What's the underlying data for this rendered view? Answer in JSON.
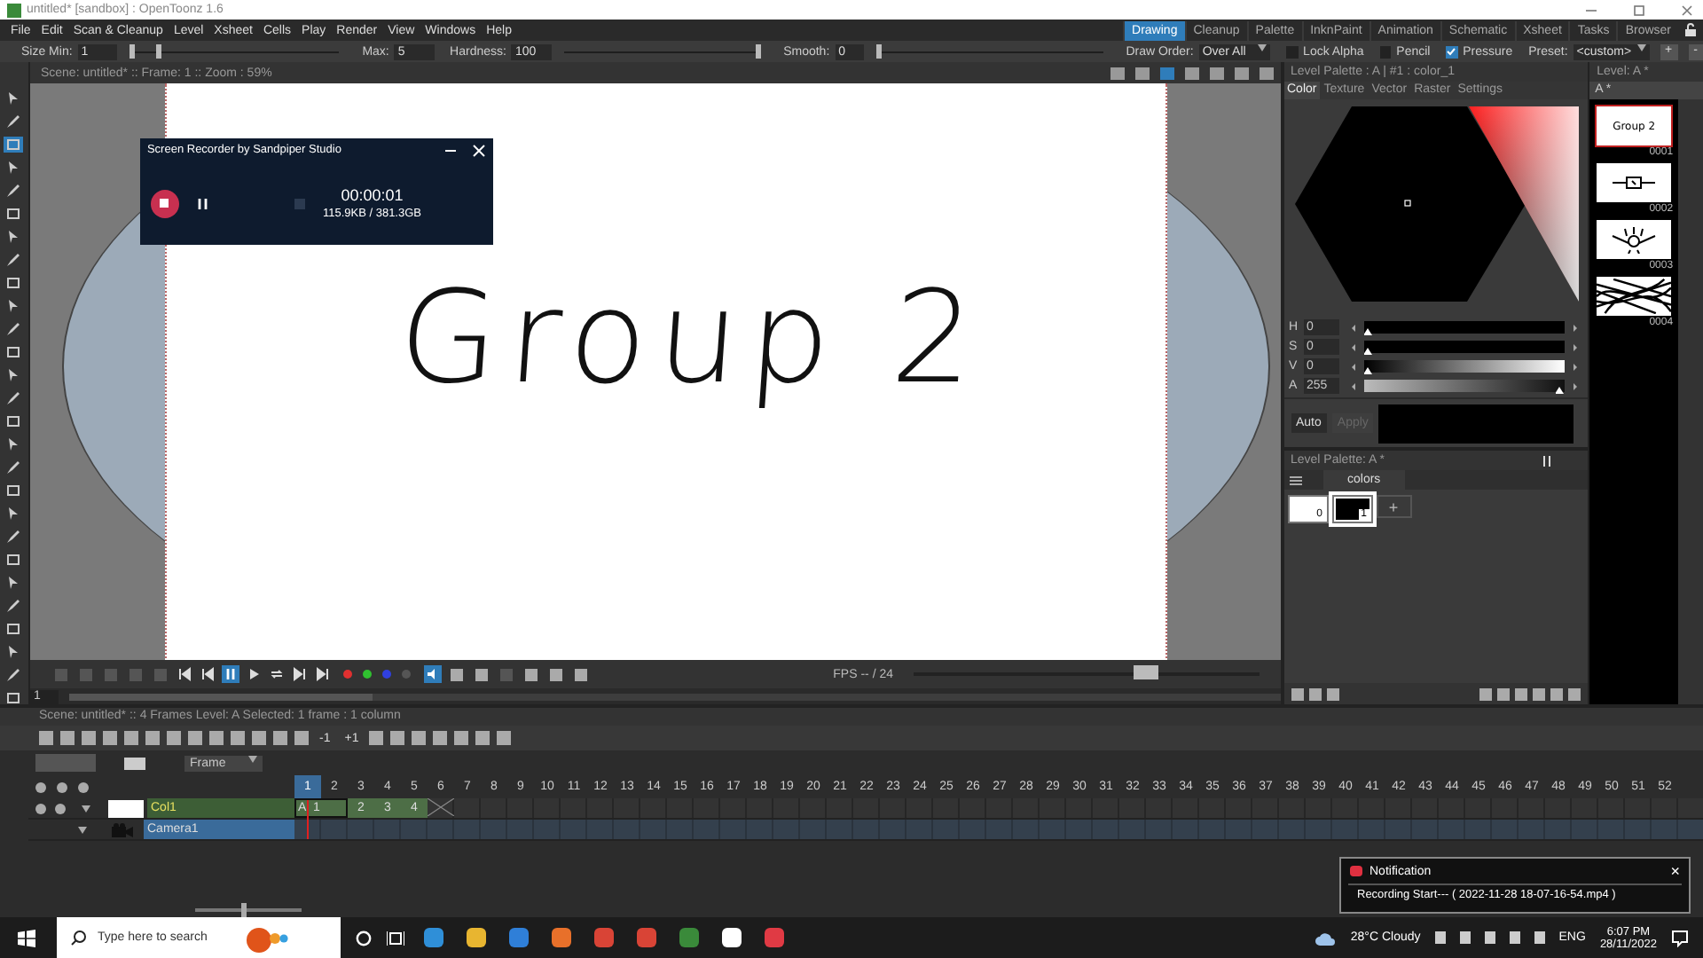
{
  "window": {
    "title": "untitled* [sandbox] : OpenToonz 1.6"
  },
  "menu": [
    "File",
    "Edit",
    "Scan & Cleanup",
    "Level",
    "Xsheet",
    "Cells",
    "Play",
    "Render",
    "View",
    "Windows",
    "Help"
  ],
  "rooms": [
    {
      "label": "Drawing",
      "selected": true
    },
    {
      "label": "Cleanup",
      "selected": false
    },
    {
      "label": "Palette",
      "selected": false
    },
    {
      "label": "InknPaint",
      "selected": false
    },
    {
      "label": "Animation",
      "selected": false
    },
    {
      "label": "Schematic",
      "selected": false
    },
    {
      "label": "Xsheet",
      "selected": false
    },
    {
      "label": "Tasks",
      "selected": false
    },
    {
      "label": "Browser",
      "selected": false
    }
  ],
  "tool_options": {
    "size_min_label": "Size Min:",
    "size_min": "1",
    "size_slider": [
      {
        "level": 0.0
      },
      {
        "level": 0.13
      }
    ],
    "max_label": "Max:",
    "max": "5",
    "hardness_label": "Hardness:",
    "hardness": "100",
    "hardness_slider": {
      "level": 1.0
    },
    "smooth_label": "Smooth:",
    "smooth": "0",
    "smooth_slider": {
      "level": 0.0
    },
    "draw_order_label": "Draw Order:",
    "draw_order": "Over All",
    "toggles": [
      {
        "label": "Lock Alpha",
        "checked": false
      },
      {
        "label": "Pencil",
        "checked": false
      },
      {
        "label": "Pressure",
        "checked": true
      }
    ],
    "preset_label": "Preset:",
    "preset": "<custom>",
    "buttons": [
      "+",
      "-"
    ]
  },
  "tools": [
    {
      "selected": false
    },
    {
      "selected": false
    },
    {
      "selected": true
    },
    {
      "selected": false
    },
    {
      "selected": false
    },
    {
      "selected": false
    },
    {
      "selected": false
    },
    {
      "selected": false
    },
    {
      "selected": false
    },
    {
      "selected": false
    },
    {
      "selected": false
    },
    {
      "selected": false
    },
    {
      "selected": false
    },
    {
      "selected": false
    },
    {
      "selected": false
    },
    {
      "selected": false
    },
    {
      "selected": false
    },
    {
      "selected": false
    },
    {
      "selected": false
    },
    {
      "selected": false
    },
    {
      "selected": false
    },
    {
      "selected": false
    },
    {
      "selected": false
    },
    {
      "selected": false
    },
    {
      "selected": false
    },
    {
      "selected": false
    },
    {
      "selected": false
    }
  ],
  "viewer": {
    "title": "Scene: untitled*  ::  Frame: 1  ::  Zoom : 59%",
    "drawing_text": "Group 2"
  },
  "recorder": {
    "title": "Screen Recorder by Sandpiper Studio",
    "time": "00:00:01",
    "size": "115.9KB / 381.3GB"
  },
  "playback": {
    "fps": "FPS -- / 24",
    "fps_slider": {
      "level": 0.69
    },
    "frame": "1",
    "frame_slider": {
      "level": 0.25
    }
  },
  "palette": {
    "title": "Level Palette : A | #1 : color_1",
    "tabs": [
      {
        "label": "Color",
        "selected": true
      },
      {
        "label": "Texture",
        "selected": false
      },
      {
        "label": "Vector",
        "selected": false
      },
      {
        "label": "Raster",
        "selected": false
      },
      {
        "label": "Settings",
        "selected": false
      }
    ],
    "channels": [
      {
        "name": "H",
        "value": "0",
        "level": 0.0
      },
      {
        "name": "S",
        "value": "0",
        "level": 0.0
      },
      {
        "name": "V",
        "value": "0",
        "level": 0.0
      },
      {
        "name": "A",
        "value": "255",
        "level": 1.0
      }
    ],
    "auto": "Auto",
    "apply": {
      "label": "Apply",
      "disabled": true
    }
  },
  "level_palette": {
    "title": "Level Palette: A *",
    "page": "colors",
    "styles": [
      {
        "index": "0",
        "selected": false
      },
      {
        "index": "1",
        "selected": true
      }
    ],
    "add": "+"
  },
  "level_strip": {
    "title": "Level: A *",
    "level": "A *",
    "frames": [
      {
        "number": "0001",
        "selected": true,
        "text": "Group 2"
      },
      {
        "number": "0002",
        "selected": false
      },
      {
        "number": "0003",
        "selected": false
      },
      {
        "number": "0004",
        "selected": false
      }
    ]
  },
  "xsheet": {
    "title": "Scene: untitled*  ::  4 Frames  Level: A   Selected: 1 frame : 1 column",
    "step_buttons": [
      "-1",
      "+1"
    ],
    "frame_mode": "Frame",
    "zoom_slider": {
      "level": 0.45
    },
    "frames": [
      {
        "label": "1",
        "selected": true
      },
      {
        "label": "2",
        "selected": false
      },
      {
        "label": "3",
        "selected": false
      },
      {
        "label": "4",
        "selected": false
      },
      {
        "label": "5",
        "selected": false
      },
      {
        "label": "6",
        "selected": false
      },
      {
        "label": "7",
        "selected": false
      },
      {
        "label": "8",
        "selected": false
      },
      {
        "label": "9",
        "selected": false
      },
      {
        "label": "10",
        "selected": false
      },
      {
        "label": "11",
        "selected": false
      },
      {
        "label": "12",
        "selected": false
      },
      {
        "label": "13",
        "selected": false
      },
      {
        "label": "14",
        "selected": false
      },
      {
        "label": "15",
        "selected": false
      },
      {
        "label": "16",
        "selected": false
      },
      {
        "label": "17",
        "selected": false
      },
      {
        "label": "18",
        "selected": false
      },
      {
        "label": "19",
        "selected": false
      },
      {
        "label": "20",
        "selected": false
      },
      {
        "label": "21",
        "selected": false
      },
      {
        "label": "22",
        "selected": false
      },
      {
        "label": "23",
        "selected": false
      },
      {
        "label": "24",
        "selected": false
      },
      {
        "label": "25",
        "selected": false
      },
      {
        "label": "26",
        "selected": false
      },
      {
        "label": "27",
        "selected": false
      },
      {
        "label": "28",
        "selected": false
      },
      {
        "label": "29",
        "selected": false
      },
      {
        "label": "30",
        "selected": false
      },
      {
        "label": "31",
        "selected": false
      },
      {
        "label": "32",
        "selected": false
      },
      {
        "label": "33",
        "selected": false
      },
      {
        "label": "34",
        "selected": false
      },
      {
        "label": "35",
        "selected": false
      },
      {
        "label": "36",
        "selected": false
      },
      {
        "label": "37",
        "selected": false
      },
      {
        "label": "38",
        "selected": false
      },
      {
        "label": "39",
        "selected": false
      },
      {
        "label": "40",
        "selected": false
      },
      {
        "label": "41",
        "selected": false
      },
      {
        "label": "42",
        "selected": false
      },
      {
        "label": "43",
        "selected": false
      },
      {
        "label": "44",
        "selected": false
      },
      {
        "label": "45",
        "selected": false
      },
      {
        "label": "46",
        "selected": false
      },
      {
        "label": "47",
        "selected": false
      },
      {
        "label": "48",
        "selected": false
      },
      {
        "label": "49",
        "selected": false
      },
      {
        "label": "50",
        "selected": false
      },
      {
        "label": "51",
        "selected": false
      },
      {
        "label": "52",
        "selected": false
      }
    ],
    "columns": [
      {
        "kind": "level",
        "name": "Col1",
        "cells": [
          "A",
          "1",
          "2",
          "3",
          "4"
        ]
      },
      {
        "kind": "camera",
        "name": "Camera1"
      }
    ]
  },
  "notification": {
    "title": "Notification",
    "message": "Recording Start--- ( 2022-11-28 18-07-16-54.mp4 )",
    "close": "×"
  },
  "taskbar": {
    "search_placeholder": "Type here to search",
    "weather": "28°C  Cloudy",
    "language": "ENG",
    "time": "6:07 PM",
    "date": "28/11/2022"
  }
}
